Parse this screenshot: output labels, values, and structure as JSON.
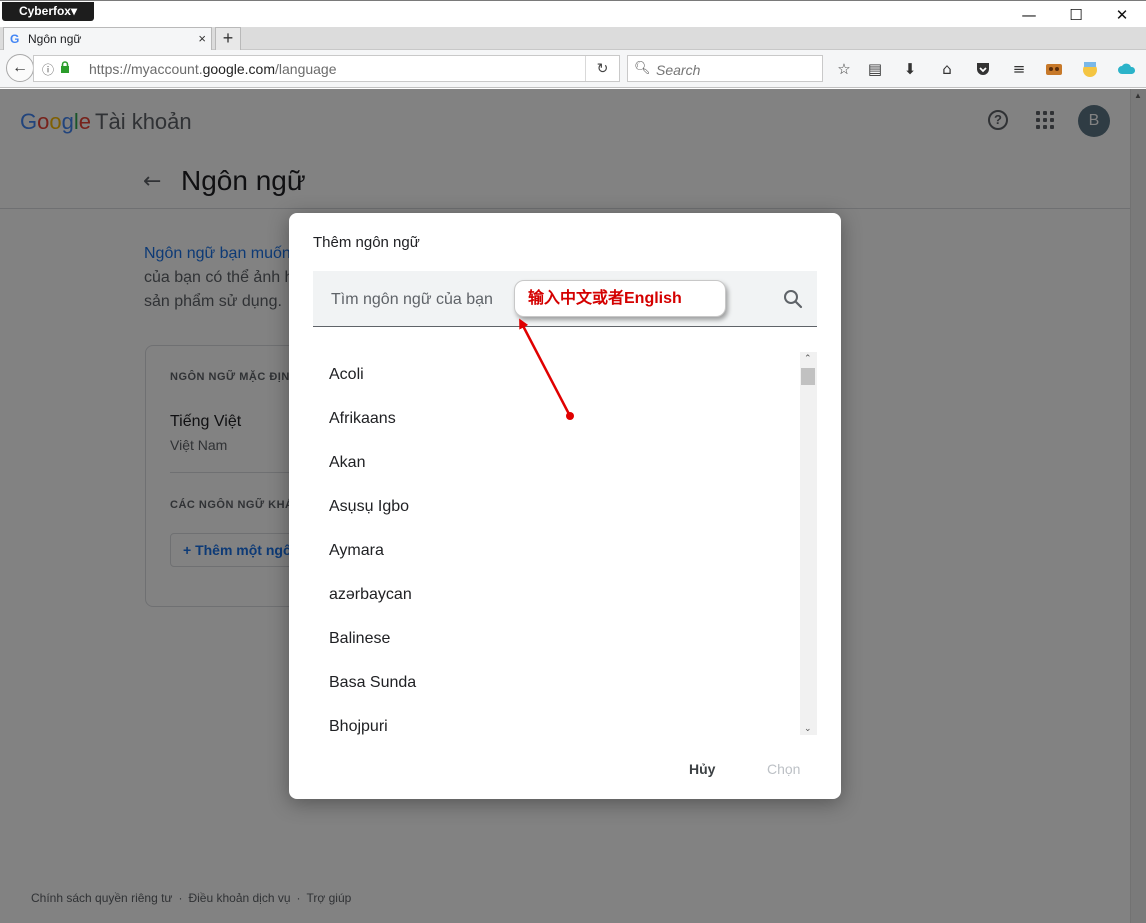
{
  "browser": {
    "app_menu": "Cyberfox▾",
    "tab_title": "Ngôn ngữ",
    "tab_favicon": "G",
    "tab_close": "×",
    "new_tab": "+",
    "url_prefix": "https://myaccount.",
    "url_domain": "google.com",
    "url_path": "/language",
    "search_placeholder": "Search",
    "window_controls": [
      "—",
      "☐",
      "✕"
    ],
    "toolbar_icons": [
      "star-icon",
      "reading-list-icon",
      "download-icon",
      "home-icon",
      "pocket-icon",
      "menu-icon",
      "extension-icon",
      "profile-icon",
      "cloud-icon"
    ]
  },
  "header": {
    "logo_letters": [
      "G",
      "o",
      "o",
      "g",
      "l",
      "e"
    ],
    "account_label": "Tài khoản",
    "avatar_letter": "B"
  },
  "page": {
    "back_arrow": "←",
    "title": "Ngôn ngữ",
    "intro_link": "Ngôn ngữ bạn muốn",
    "intro_line2": "của bạn có thể ảnh h",
    "intro_line3": "sản phẩm sử dụng.",
    "default_section": "NGÔN NGỮ MẶC ĐỊNH",
    "default_language": "Tiếng Việt",
    "default_region": "Việt Nam",
    "other_section": "CÁC NGÔN NGỮ KHÁC",
    "add_button": "+  Thêm một ngôn ngữ"
  },
  "footer": {
    "links": [
      "Chính sách quyền riêng tư",
      "Điều khoản dịch vụ",
      "Trợ giúp"
    ],
    "separator": "·"
  },
  "dialog": {
    "title": "Thêm ngôn ngữ",
    "search_placeholder": "Tìm ngôn ngữ của bạn",
    "languages": [
      "Acoli",
      "Afrikaans",
      "Akan",
      "Asụsụ Igbo",
      "Aymara",
      "azərbaycan",
      "Balinese",
      "Basa Sunda",
      "Bhojpuri"
    ],
    "cancel": "Hủy",
    "select": "Chọn"
  },
  "annotation": {
    "callout_text": "输入中文或者English",
    "color": "#e00000"
  }
}
